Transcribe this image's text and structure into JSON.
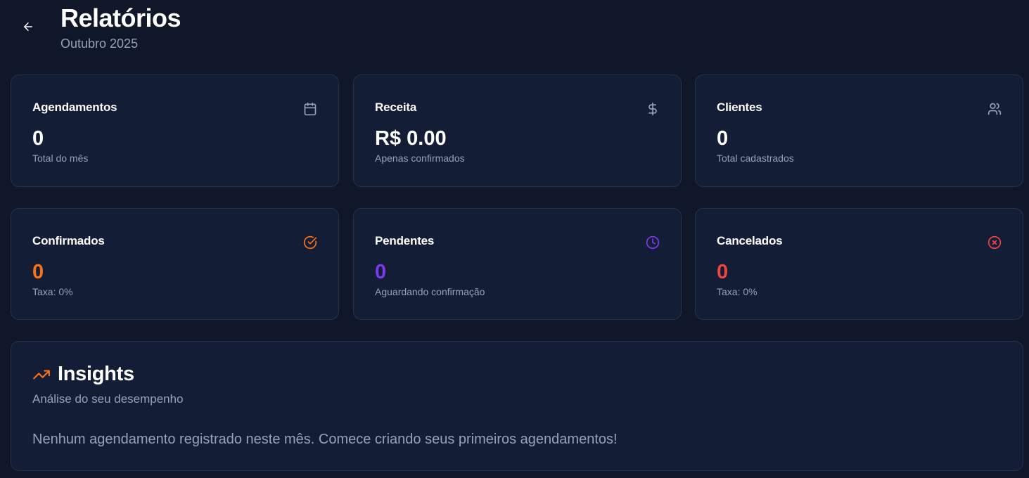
{
  "header": {
    "title": "Relatórios",
    "subtitle": "Outubro 2025",
    "back_icon": "arrow-left-icon"
  },
  "stats": [
    {
      "title": "Agendamentos",
      "value": "0",
      "description": "Total do mês",
      "icon": "calendar-icon",
      "value_color": "#ffffff",
      "icon_color": "#94a3b8"
    },
    {
      "title": "Receita",
      "value": "R$ 0.00",
      "description": "Apenas confirmados",
      "icon": "dollar-icon",
      "value_color": "#ffffff",
      "icon_color": "#94a3b8"
    },
    {
      "title": "Clientes",
      "value": "0",
      "description": "Total cadastrados",
      "icon": "users-icon",
      "value_color": "#ffffff",
      "icon_color": "#94a3b8"
    },
    {
      "title": "Confirmados",
      "value": "0",
      "description": "Taxa: 0%",
      "icon": "check-circle-icon",
      "value_color": "#f97316",
      "icon_color": "#f97316"
    },
    {
      "title": "Pendentes",
      "value": "0",
      "description": "Aguardando confirmação",
      "icon": "clock-icon",
      "value_color": "#7c3aed",
      "icon_color": "#7c3aed"
    },
    {
      "title": "Cancelados",
      "value": "0",
      "description": "Taxa: 0%",
      "icon": "x-circle-icon",
      "value_color": "#ef4444",
      "icon_color": "#ef4444"
    }
  ],
  "insights": {
    "title": "Insights",
    "subtitle": "Análise do seu desempenho",
    "message": "Nenhum agendamento registrado neste mês. Comece criando seus primeiros agendamentos!",
    "icon": "trending-up-icon",
    "icon_color": "#f97316"
  },
  "colors": {
    "background": "#0f1729",
    "card": "#131d35",
    "border": "#26324a",
    "muted_text": "#94a3b8",
    "accent_orange": "#f97316",
    "accent_purple": "#7c3aed",
    "accent_red": "#ef4444"
  }
}
